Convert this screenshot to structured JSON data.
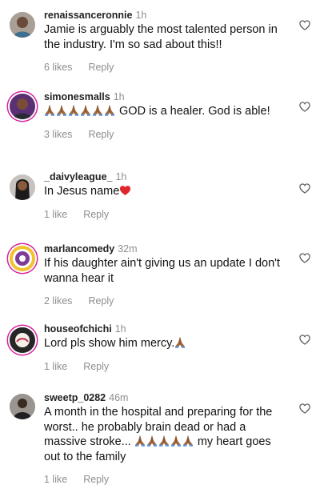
{
  "comments": [
    {
      "username": "renaissanceronnie",
      "time": "1h",
      "text": "Jamie is arguably the most talented person in the industry. I'm so sad about this!!",
      "likes": "6 likes",
      "reply": "Reply"
    },
    {
      "username": "simonesmalls",
      "time": "1h",
      "text": "GOD is a healer. God is able!",
      "likes": "3 likes",
      "reply": "Reply"
    },
    {
      "username": "_daivyleague_",
      "time": "1h",
      "text": "In Jesus name",
      "likes": "1 like",
      "reply": "Reply"
    },
    {
      "username": "marlancomedy",
      "time": "32m",
      "text": "If his daughter ain't giving us an update I don't wanna hear it",
      "likes": "2 likes",
      "reply": "Reply"
    },
    {
      "username": "houseofchichi",
      "time": "1h",
      "text": "Lord pls show him mercy.",
      "likes": "1 like",
      "reply": "Reply"
    },
    {
      "username": "sweetp_0282",
      "time": "46m",
      "text_start": "A month in the hospital and preparing for the worst.. he probably brain dead or  had a massive stroke... ",
      "text_end": " my heart goes out to the family",
      "likes": "1 like",
      "reply": "Reply"
    }
  ],
  "icons": {
    "like": "heart-outline-icon",
    "praying_hands": "folded-hands-emoji",
    "red_heart": "red-heart-emoji"
  }
}
